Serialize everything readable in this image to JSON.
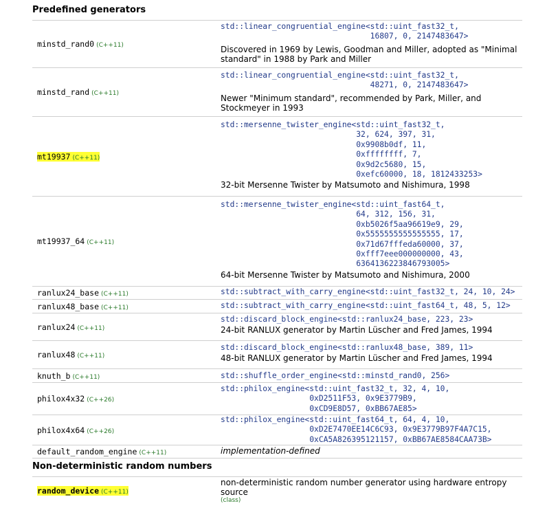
{
  "sections": {
    "predefined": "Predefined generators",
    "nondeterministic": "Non-deterministic random numbers"
  },
  "rows": [
    {
      "name": "minstd_rand0",
      "version": "(C++11)",
      "code": "std::linear_congruential_engine<std::uint_fast32_t,\n                                16807, 0, 2147483647>",
      "desc": "Discovered in 1969 by Lewis, Goodman and Miller, adopted as \"Minimal standard\" in 1988 by Park and Miller"
    },
    {
      "name": "minstd_rand",
      "version": "(C++11)",
      "code": "std::linear_congruential_engine<std::uint_fast32_t,\n                                48271, 0, 2147483647>",
      "desc": "Newer \"Minimum standard\", recommended by Park, Miller, and Stockmeyer in 1993"
    },
    {
      "name": "mt19937",
      "version": "(C++11)",
      "code": "std::mersenne_twister_engine<std::uint_fast32_t,\n                             32, 624, 397, 31,\n                             0x9908b0df, 11,\n                             0xffffffff, 7,\n                             0x9d2c5680, 15,\n                             0xefc60000, 18, 1812433253>",
      "desc": "32-bit Mersenne Twister by Matsumoto and Nishimura, 1998"
    },
    {
      "name": "mt19937_64",
      "version": "(C++11)",
      "code": "std::mersenne_twister_engine<std::uint_fast64_t,\n                             64, 312, 156, 31,\n                             0xb5026f5aa96619e9, 29,\n                             0x5555555555555555, 17,\n                             0x71d67fffeda60000, 37,\n                             0xfff7eee000000000, 43,\n                             6364136223846793005>",
      "desc": "64-bit Mersenne Twister by Matsumoto and Nishimura, 2000"
    },
    {
      "name": "ranlux24_base",
      "version": "(C++11)",
      "code": "std::subtract_with_carry_engine<std::uint_fast32_t, 24, 10, 24>",
      "desc": ""
    },
    {
      "name": "ranlux48_base",
      "version": "(C++11)",
      "code": "std::subtract_with_carry_engine<std::uint_fast64_t, 48, 5, 12>",
      "desc": ""
    },
    {
      "name": "ranlux24",
      "version": "(C++11)",
      "code": "std::discard_block_engine<std::ranlux24_base, 223, 23>",
      "desc": "24-bit RANLUX generator by Martin Lüscher and Fred James, 1994"
    },
    {
      "name": "ranlux48",
      "version": "(C++11)",
      "code": "std::discard_block_engine<std::ranlux48_base, 389, 11>",
      "desc": "48-bit RANLUX generator by Martin Lüscher and Fred James, 1994"
    },
    {
      "name": "knuth_b",
      "version": "(C++11)",
      "code": "std::shuffle_order_engine<std::minstd_rand0, 256>",
      "desc": ""
    },
    {
      "name": "philox4x32",
      "version": "(C++26)",
      "code": "std::philox_engine<std::uint_fast32_t, 32, 4, 10,\n                   0xD2511F53, 0x9E3779B9,\n                   0xCD9E8D57, 0xBB67AE85>",
      "desc": ""
    },
    {
      "name": "philox4x64",
      "version": "(C++26)",
      "code": "std::philox_engine<std::uint_fast64_t, 64, 4, 10,\n                   0xD2E7470EE14C6C93, 0x9E3779B97F4A7C15,\n                   0xCA5A826395121157, 0xBB67AE8584CAA73B>",
      "desc": ""
    },
    {
      "name": "default_random_engine",
      "version": "(C++11)",
      "code": "",
      "desc": "implementation-defined"
    },
    {
      "name": "random_device",
      "version": "(C++11)",
      "code": "",
      "desc": "non-deterministic random number generator using hardware entropy source",
      "tag": "(class)"
    }
  ]
}
